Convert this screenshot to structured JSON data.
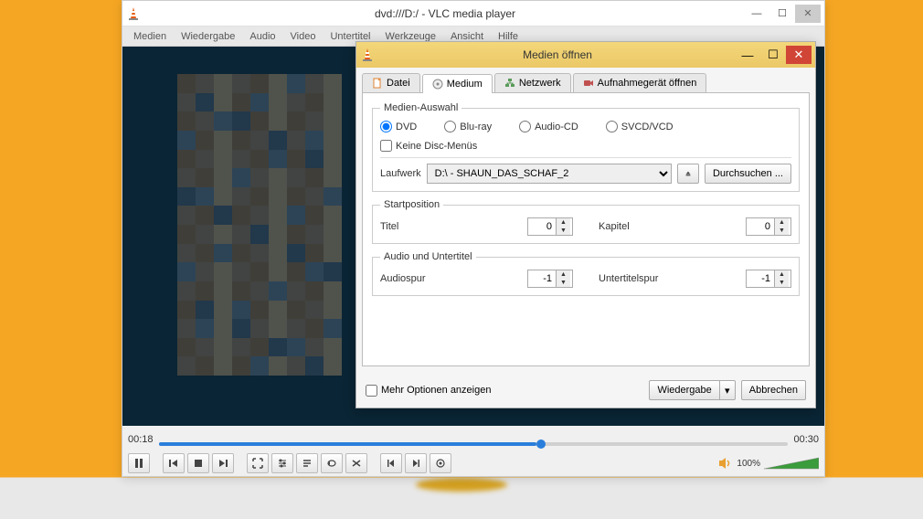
{
  "main": {
    "title": "dvd:///D:/ - VLC media player",
    "menus": [
      "Medien",
      "Wiedergabe",
      "Audio",
      "Video",
      "Untertitel",
      "Werkzeuge",
      "Ansicht",
      "Hilfe"
    ],
    "time_current": "00:18",
    "time_total": "00:30",
    "volume_percent": "100%"
  },
  "dialog": {
    "title": "Medien öffnen",
    "tabs": {
      "file": "Datei",
      "disc": "Medium",
      "network": "Netzwerk",
      "capture": "Aufnahmegerät öffnen"
    },
    "media_selection_legend": "Medien-Auswahl",
    "radio_dvd": "DVD",
    "radio_bluray": "Blu-ray",
    "radio_audiocd": "Audio-CD",
    "radio_svcd": "SVCD/VCD",
    "no_menus": "Keine Disc-Menüs",
    "drive_label": "Laufwerk",
    "drive_value": "D:\\ - SHAUN_DAS_SCHAF_2",
    "browse": "Durchsuchen ...",
    "start_legend": "Startposition",
    "title_label": "Titel",
    "title_value": "0",
    "chapter_label": "Kapitel",
    "chapter_value": "0",
    "av_legend": "Audio und Untertitel",
    "audiotrack_label": "Audiospur",
    "audiotrack_value": "-1",
    "subtrack_label": "Untertitelspur",
    "subtrack_value": "-1",
    "more_options": "Mehr Optionen anzeigen",
    "play": "Wiedergabe",
    "cancel": "Abbrechen"
  }
}
